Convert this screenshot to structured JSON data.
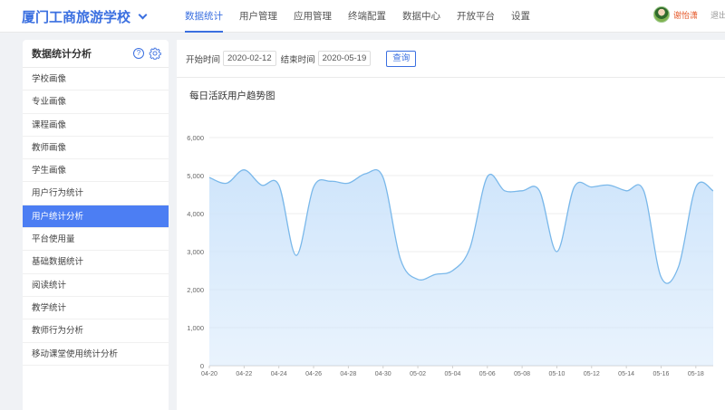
{
  "header": {
    "brand": "厦门工商旅游学校",
    "nav": [
      "数据统计",
      "用户管理",
      "应用管理",
      "终端配置",
      "数据中心",
      "开放平台",
      "设置"
    ],
    "active_nav": 0,
    "user_name": "谢怡潇",
    "logout": "退出"
  },
  "sidebar": {
    "title": "数据统计分析",
    "help_glyph": "?",
    "items": [
      "学校画像",
      "专业画像",
      "课程画像",
      "教师画像",
      "学生画像",
      "用户行为统计",
      "用户统计分析",
      "平台使用量",
      "基础数据统计",
      "阅读统计",
      "教学统计",
      "教师行为分析",
      "移动课堂使用统计分析"
    ],
    "active_index": 6
  },
  "filter": {
    "start_label": "开始时间",
    "start_value": "2020-02-12",
    "end_label": "结束时间",
    "end_value": "2020-05-19",
    "query_label": "查询"
  },
  "colors": {
    "accent": "#3a6fe0",
    "active_menu": "#4c7ef3",
    "line": "#7ab8ea",
    "area": "#cfe5fb"
  },
  "chart_data": {
    "type": "area",
    "title": "每日活跃用户趋势图",
    "x": [
      "04-20",
      "04-21",
      "04-22",
      "04-23",
      "04-24",
      "04-25",
      "04-26",
      "04-27",
      "04-28",
      "04-29",
      "04-30",
      "05-01",
      "05-02",
      "05-03",
      "05-04",
      "05-05",
      "05-06",
      "05-07",
      "05-08",
      "05-09",
      "05-10",
      "05-11",
      "05-12",
      "05-13",
      "05-14",
      "05-15",
      "05-16",
      "05-17",
      "05-18",
      "05-19"
    ],
    "x_tick_labels": [
      "04-20",
      "04-22",
      "04-24",
      "04-26",
      "04-28",
      "04-30",
      "05-02",
      "05-04",
      "05-06",
      "05-08",
      "05-10",
      "05-12",
      "05-14",
      "05-16",
      "05-18"
    ],
    "series": [
      {
        "values": [
          4950,
          4800,
          5150,
          4750,
          4750,
          2900,
          4700,
          4850,
          4800,
          5050,
          4950,
          2800,
          2270,
          2400,
          2500,
          3100,
          4970,
          4600,
          4600,
          4600,
          3000,
          4700,
          4700,
          4750,
          4600,
          4600,
          2330,
          2600,
          4700,
          4600
        ]
      }
    ],
    "ylim": [
      0,
      6000
    ],
    "y_ticks": [
      "0",
      "1,000",
      "2,000",
      "3,000",
      "4,000",
      "5,000",
      "6,000"
    ],
    "grid": true,
    "legend": "none"
  }
}
